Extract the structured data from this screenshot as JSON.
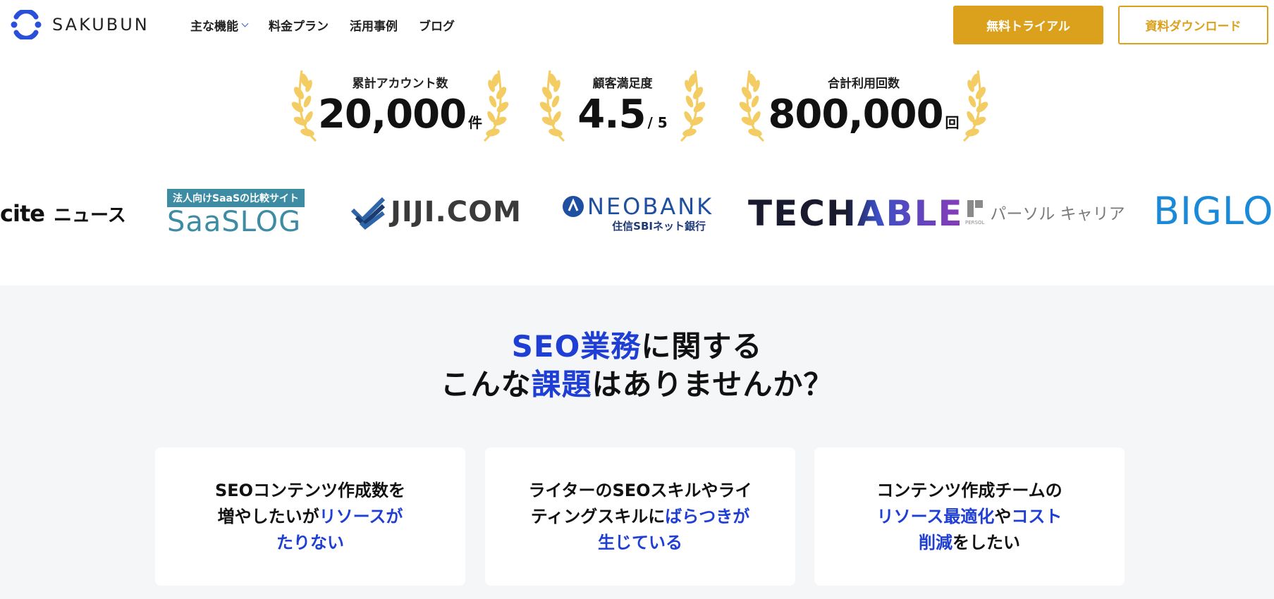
{
  "header": {
    "logo_text": "SAKUBUN",
    "nav": [
      {
        "label": "主な機能",
        "has_dropdown": true
      },
      {
        "label": "料金プラン"
      },
      {
        "label": "活用事例"
      },
      {
        "label": "ブログ"
      }
    ],
    "trial_button": "無料トライアル",
    "download_button": "資料ダウンロード"
  },
  "stats": [
    {
      "label": "累計アカウント数",
      "value": "20,000",
      "unit": "件"
    },
    {
      "label": "顧客満足度",
      "value": "4.5",
      "unit": "/ 5"
    },
    {
      "label": "合計利用回数",
      "value": "800,000",
      "unit": "回"
    }
  ],
  "logos": {
    "excite": "cite",
    "excite_suffix": "ニュース",
    "saaslog_tag": "法人向けSaaSの比較サイト",
    "saaslog": "SaaSLOG",
    "jiji": "JIJI.COM",
    "neobank": "NEOBANK",
    "neobank_sub": "住信SBIネット銀行",
    "techable": "TECHABLE",
    "persol": "パーソル キャリア",
    "persol_small": "PERSOL",
    "biglobe": "BIGLO"
  },
  "problem": {
    "heading_line1_blue": "SEO業務",
    "heading_line1_rest": "に関する",
    "heading_line2_pre": "こんな",
    "heading_line2_blue": "課題",
    "heading_line2_post": "はありませんか？",
    "cards": [
      {
        "l1": "SEOコンテンツ作成数を",
        "l2_pre": "増やしたいが",
        "l2_blue": "リソースが",
        "l3_blue": "たりない"
      },
      {
        "l1": "ライターのSEOスキルやライ",
        "l2_pre": "ティングスキルに",
        "l2_blue": "ばらつきが",
        "l3_blue": "生じている"
      },
      {
        "l1": "コンテンツ作成チームの",
        "l2_blue1": "リソース最適化",
        "l2_mid": "や",
        "l2_blue2": "コスト",
        "l3_blue": "削減",
        "l3_post": "をしたい"
      }
    ]
  },
  "colors": {
    "accent_gold": "#dba11c",
    "laurel": "#f3cd63",
    "blue": "#1f3fd4",
    "logo_blue": "#2a4fd8"
  }
}
